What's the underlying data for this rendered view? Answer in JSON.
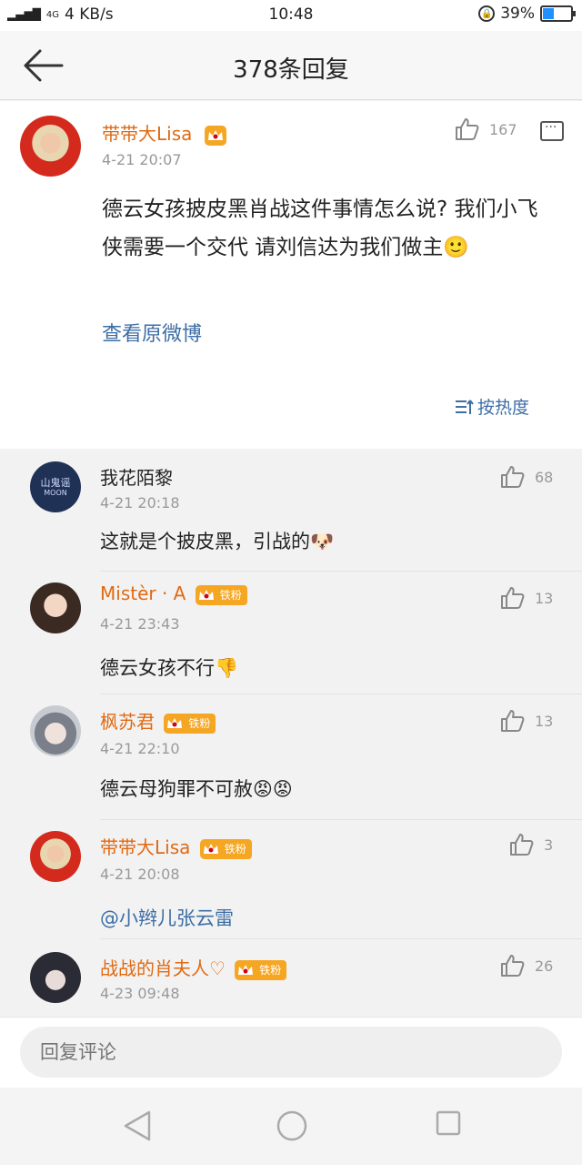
{
  "status_bar": {
    "network": "4G",
    "speed": "4 KB/s",
    "time": "10:48",
    "battery": "39%",
    "battery_level": 0.39
  },
  "header": {
    "title": "378条回复"
  },
  "main_post": {
    "user": "带带大Lisa",
    "time": "4-21 20:07",
    "likes": "167",
    "text": "德云女孩披皮黑肖战这件事情怎么说? 我们小飞侠需要一个交代 请刘信达为我们做主🙂",
    "view_original": "查看原微博",
    "sort_label": "按热度"
  },
  "comments": [
    {
      "user": "我花陌黎",
      "time": "4-21 20:18",
      "likes": "68",
      "text": "这就是个披皮黑，引战的🐶",
      "avatar_text": "山鬼谣",
      "avatar_sub": "MOON",
      "badge": ""
    },
    {
      "user": "Mistèr · A",
      "time": "4-21 23:43",
      "likes": "13",
      "text": "德云女孩不行👎",
      "badge": "铁粉"
    },
    {
      "user": "枫苏君",
      "time": "4-21 22:10",
      "likes": "13",
      "text": "德云母狗罪不可赦😡😡",
      "badge": "铁粉"
    },
    {
      "user": "带带大Lisa",
      "time": "4-21 20:08",
      "likes": "3",
      "text": "@小辫儿张云雷",
      "badge": "铁粉"
    },
    {
      "user": "战战的肖夫人♡",
      "time": "4-23 09:48",
      "likes": "26",
      "text": "",
      "badge": "铁粉"
    }
  ],
  "reply": {
    "placeholder": "回复评论"
  }
}
